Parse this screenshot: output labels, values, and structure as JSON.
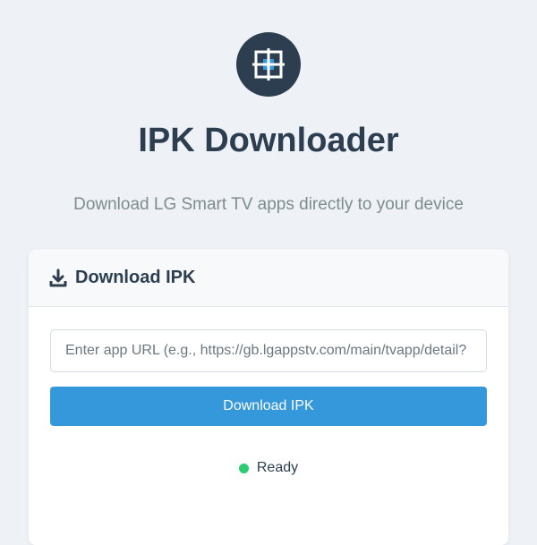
{
  "app": {
    "title": "IPK Downloader",
    "subtitle": "Download LG Smart TV apps directly to your device",
    "logo_icon": "grid-scan-icon"
  },
  "card": {
    "header_icon": "download-icon",
    "header_title": "Download IPK",
    "url_input": {
      "value": "",
      "placeholder": "Enter app URL (e.g., https://gb.lgappstv.com/main/tvapp/detail?"
    },
    "download_button_label": "Download IPK"
  },
  "status": {
    "text": "Ready",
    "color": "#2ecc71"
  },
  "colors": {
    "accent": "#3498db",
    "dark": "#2c3e50",
    "muted": "#7f8c8d",
    "background": "#eef1f5"
  }
}
